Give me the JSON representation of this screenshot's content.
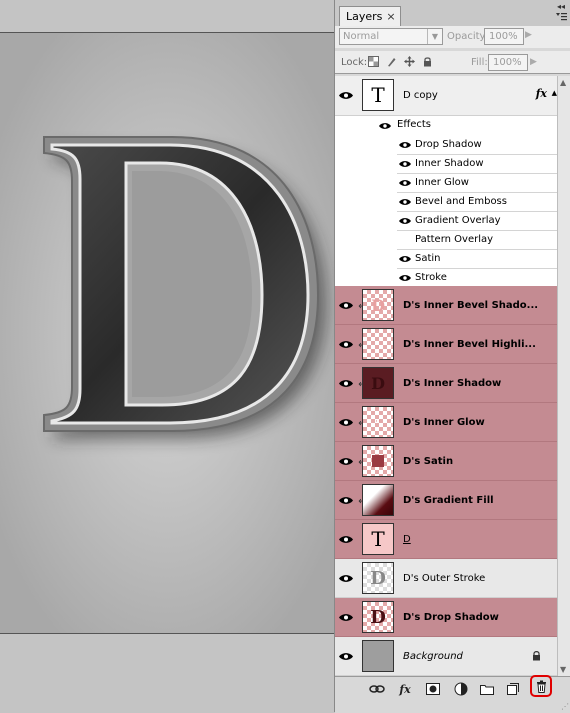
{
  "panel": {
    "tab_label": "Layers",
    "tab_close": "×",
    "blend_mode": "Normal",
    "opacity_label": "Opacity:",
    "opacity_value": "100%",
    "lock_label": "Lock:",
    "fill_label": "Fill:",
    "fill_value": "100%"
  },
  "canvas": {
    "letter": "D"
  },
  "layers": {
    "copy": {
      "name": "D copy",
      "thumb_glyph": "T",
      "fx": "fx"
    },
    "effects_label": "Effects",
    "effects": [
      {
        "name": "Drop Shadow",
        "visible": true
      },
      {
        "name": "Inner Shadow",
        "visible": true
      },
      {
        "name": "Inner Glow",
        "visible": true
      },
      {
        "name": "Bevel and Emboss",
        "visible": true
      },
      {
        "name": "Gradient Overlay",
        "visible": true
      },
      {
        "name": "Pattern Overlay",
        "visible": false
      },
      {
        "name": "Satin",
        "visible": true
      },
      {
        "name": "Stroke",
        "visible": true
      }
    ],
    "items": [
      {
        "name": "D's Inner Bevel Shado...",
        "bold": true,
        "clipped": true
      },
      {
        "name": "D's Inner Bevel Highli...",
        "bold": true,
        "clipped": true
      },
      {
        "name": "D's Inner Shadow",
        "bold": true,
        "clipped": true
      },
      {
        "name": "D's Inner Glow",
        "bold": true,
        "clipped": true
      },
      {
        "name": "D's Satin",
        "bold": true,
        "clipped": true
      },
      {
        "name": "D's Gradient Fill",
        "bold": true,
        "clipped": true
      },
      {
        "name": "D",
        "bold": false,
        "clipped": false
      },
      {
        "name": "D's Outer Stroke",
        "bold": false,
        "clipped": false
      },
      {
        "name": "D's Drop Shadow",
        "bold": true,
        "clipped": false
      },
      {
        "name": "Background",
        "bold": false,
        "clipped": false
      }
    ],
    "text_glyph": "T",
    "d_glyph": "D"
  },
  "colors": {
    "selected_row": "#c48b92",
    "delete_highlight": "#e00000"
  }
}
